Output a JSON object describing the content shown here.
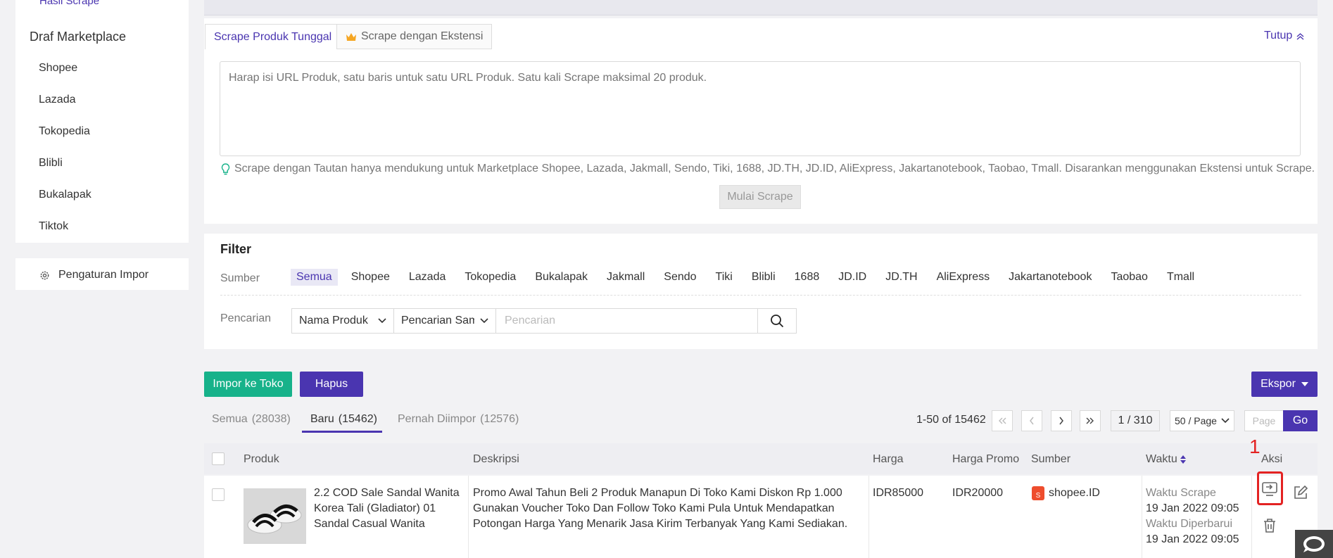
{
  "sidebar": {
    "cut_item": "Hasil Scrape",
    "section_title": "Draf Marketplace",
    "items": [
      {
        "label": "Shopee"
      },
      {
        "label": "Lazada"
      },
      {
        "label": "Tokopedia"
      },
      {
        "label": "Blibli"
      },
      {
        "label": "Bukalapak"
      },
      {
        "label": "Tiktok"
      }
    ],
    "settings_label": "Pengaturan Impor"
  },
  "scrape": {
    "tab_single": "Scrape Produk Tunggal",
    "tab_extension": "Scrape dengan Ekstensi",
    "collapse_label": "Tutup",
    "url_placeholder": "Harap isi URL Produk, satu baris untuk satu URL Produk. Satu kali Scrape maksimal 20 produk.",
    "hint": "Scrape dengan Tautan hanya mendukung untuk Marketplace Shopee, Lazada, Jakmall, Sendo, Tiki, 1688, JD.TH, JD.ID, AliExpress, Jakartanotebook, Taobao, Tmall. Disarankan menggunakan Ekstensi untuk Scrape.",
    "start_button": "Mulai Scrape"
  },
  "filter": {
    "title": "Filter",
    "source_label": "Sumber",
    "sources": [
      {
        "label": "Semua"
      },
      {
        "label": "Shopee"
      },
      {
        "label": "Lazada"
      },
      {
        "label": "Tokopedia"
      },
      {
        "label": "Bukalapak"
      },
      {
        "label": "Jakmall"
      },
      {
        "label": "Sendo"
      },
      {
        "label": "Tiki"
      },
      {
        "label": "Blibli"
      },
      {
        "label": "1688"
      },
      {
        "label": "JD.ID"
      },
      {
        "label": "JD.TH"
      },
      {
        "label": "AliExpress"
      },
      {
        "label": "Jakartanotebook"
      },
      {
        "label": "Taobao"
      },
      {
        "label": "Tmall"
      }
    ],
    "active_source": "Semua",
    "search_label": "Pencarian",
    "field_select": "Nama Produk",
    "match_select": "Pencarian Sam",
    "search_placeholder": "Pencarian"
  },
  "actions": {
    "import_button": "Impor ke Toko",
    "delete_button": "Hapus",
    "export_button": "Ekspor"
  },
  "status_tabs": [
    {
      "label": "Semua",
      "count": "(28038)"
    },
    {
      "label": "Baru",
      "count": "(15462)"
    },
    {
      "label": "Pernah Diimpor",
      "count": "(12576)"
    }
  ],
  "active_status_tab": "Baru",
  "pagination": {
    "info": "1-50 of 15462",
    "current": "1 / 310",
    "page_size": "50 / Page",
    "page_placeholder": "Page",
    "go_label": "Go"
  },
  "table": {
    "headers": {
      "product": "Produk",
      "description": "Deskripsi",
      "price": "Harga",
      "promo_price": "Harga Promo",
      "source": "Sumber",
      "time": "Waktu",
      "actions": "Aksi"
    },
    "rows": [
      {
        "name": "2.2 COD Sale Sandal Wanita Korea Tali (Gladiator) 01 Sandal Casual Wanita",
        "description": "Promo Awal Tahun Beli 2 Produk Manapun Di Toko Kami Diskon Rp 1.000 Gunakan Voucher Toko Dan Follow Toko Kami Pula Untuk Mendapatkan Potongan Harga Yang Menarik Jasa Kirim Terbanyak Yang Kami Sediakan. Bisa...",
        "price": "IDR85000",
        "promo_price": "IDR20000",
        "source": "shopee.ID",
        "scrape_label": "Waktu Scrape",
        "scrape_time": "19 Jan 2022 09:05",
        "update_label": "Waktu Diperbarui",
        "update_time": "19 Jan 2022 09:05"
      }
    ]
  },
  "annotation": {
    "number": "1"
  },
  "colors": {
    "accent": "#4a35b0",
    "green": "#17b28a",
    "annotation": "#e32222",
    "shopee": "#ee4d2d"
  }
}
